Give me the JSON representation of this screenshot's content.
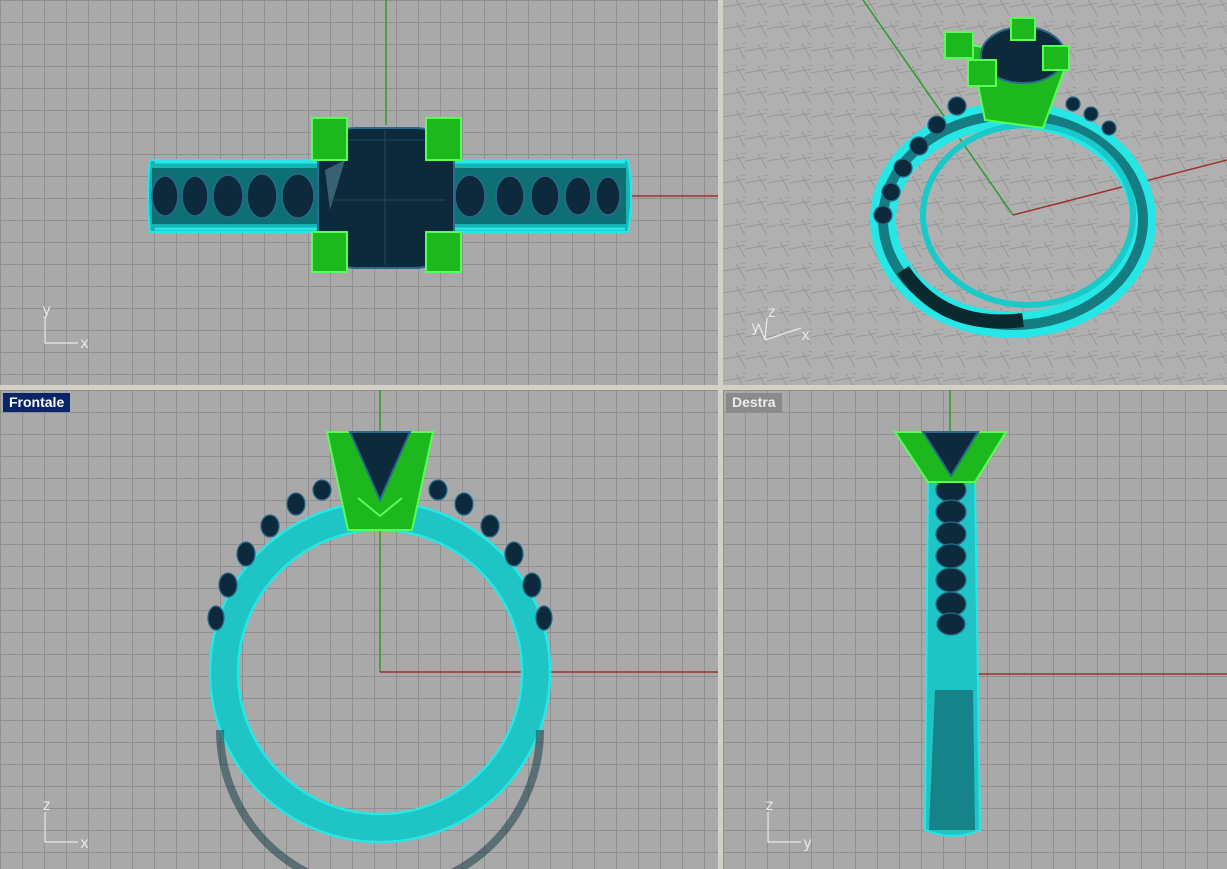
{
  "viewports": {
    "top": {
      "title": "",
      "axis": {
        "vertical": "y",
        "horizontal": "x"
      }
    },
    "perspective": {
      "title": "",
      "axis": {
        "vertical_a": "y",
        "vertical_b": "z",
        "horizontal": "x"
      }
    },
    "front": {
      "title": "Frontale",
      "active": true,
      "axis": {
        "vertical": "z",
        "horizontal": "x"
      }
    },
    "right": {
      "title": "Destra",
      "active": false,
      "axis": {
        "vertical": "z",
        "horizontal": "y"
      }
    }
  },
  "colors": {
    "viewport_bg": "#a9a9a9",
    "grid": "#8f8f8f",
    "separator": "#d4d0c8",
    "x_axis": "#a03030",
    "y_axis": "#2e9a2e",
    "band_selected": "#26e6e6",
    "band_dark": "#0a2a30",
    "prong": "#1db81d",
    "prong_edge": "#55ff55",
    "gem": "#0d2a3c",
    "gem_edge": "#2a6a8a",
    "title_active_bg": "#0a246a",
    "title_inactive_bg": "#8a8a8a"
  }
}
